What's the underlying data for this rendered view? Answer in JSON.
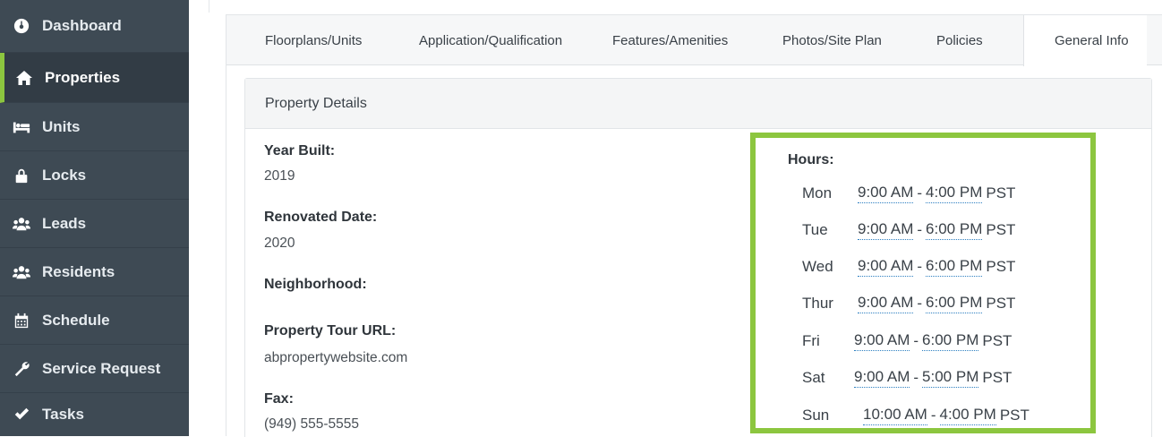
{
  "sidebar": {
    "items": [
      {
        "label": "Dashboard",
        "icon": "dashboard-icon"
      },
      {
        "label": "Properties",
        "icon": "home-icon"
      },
      {
        "label": "Units",
        "icon": "bed-icon"
      },
      {
        "label": "Locks",
        "icon": "lock-icon"
      },
      {
        "label": "Leads",
        "icon": "users-icon"
      },
      {
        "label": "Residents",
        "icon": "users-icon"
      },
      {
        "label": "Schedule",
        "icon": "calendar-icon"
      },
      {
        "label": "Service Request",
        "icon": "wrench-icon"
      },
      {
        "label": "Tasks",
        "icon": "check-icon"
      }
    ],
    "active": "Properties",
    "accent_color": "#8cc63f"
  },
  "tabs": [
    {
      "label": "Floorplans/Units"
    },
    {
      "label": "Application/Qualification"
    },
    {
      "label": "Features/Amenities"
    },
    {
      "label": "Photos/Site Plan"
    },
    {
      "label": "Policies"
    },
    {
      "label": "General Info"
    }
  ],
  "active_tab": "General Info",
  "property_details": {
    "header": "Property Details",
    "fields": [
      {
        "label": "Year Built:",
        "value": "2019"
      },
      {
        "label": "Renovated Date:",
        "value": "2020"
      },
      {
        "label": "Neighborhood:",
        "value": ""
      },
      {
        "label": "Property Tour URL:",
        "value": "abpropertywebsite.com"
      },
      {
        "label": "Fax:",
        "value": "(949) 555-5555"
      }
    ]
  },
  "hours": {
    "label": "Hours:",
    "highlight_color": "#8cc63f",
    "rows": [
      {
        "day": "Mon",
        "open": "9:00 AM",
        "close": "4:00 PM",
        "tz": "PST"
      },
      {
        "day": "Tue",
        "open": "9:00 AM",
        "close": "6:00 PM",
        "tz": "PST"
      },
      {
        "day": "Wed",
        "open": "9:00 AM",
        "close": "6:00 PM",
        "tz": "PST"
      },
      {
        "day": "Thur",
        "open": "9:00 AM",
        "close": "6:00 PM",
        "tz": "PST"
      },
      {
        "day": "Fri",
        "open": "9:00 AM",
        "close": "6:00 PM",
        "tz": "PST"
      },
      {
        "day": "Sat",
        "open": "9:00 AM",
        "close": "5:00 PM",
        "tz": "PST"
      },
      {
        "day": "Sun",
        "open": "10:00 AM",
        "close": "4:00 PM",
        "tz": "PST"
      }
    ]
  }
}
